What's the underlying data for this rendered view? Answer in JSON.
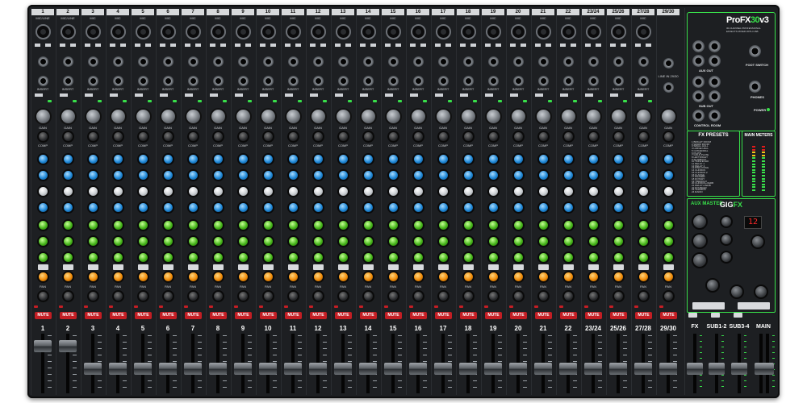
{
  "product": {
    "brand": "ProFX30v3",
    "brand_main": "ProFX",
    "brand_accent": "30",
    "brand_suffix": "v3",
    "subtitle": "30-CHANNEL PROFESSIONAL EFFECTS MIXER WITH USB"
  },
  "channels": [
    {
      "num": "1",
      "mic": "MIC/LINE",
      "label": "1"
    },
    {
      "num": "2",
      "mic": "MIC/LINE",
      "label": "2"
    },
    {
      "num": "3",
      "mic": "MIC",
      "label": "3"
    },
    {
      "num": "4",
      "mic": "MIC",
      "label": "4"
    },
    {
      "num": "5",
      "mic": "MIC",
      "label": "5"
    },
    {
      "num": "6",
      "mic": "MIC",
      "label": "6"
    },
    {
      "num": "7",
      "mic": "MIC",
      "label": "7"
    },
    {
      "num": "8",
      "mic": "MIC",
      "label": "8"
    },
    {
      "num": "9",
      "mic": "MIC",
      "label": "9"
    },
    {
      "num": "10",
      "mic": "MIC",
      "label": "10"
    },
    {
      "num": "11",
      "mic": "MIC",
      "label": "11"
    },
    {
      "num": "12",
      "mic": "MIC",
      "label": "12"
    },
    {
      "num": "13",
      "mic": "MIC",
      "label": "13"
    },
    {
      "num": "14",
      "mic": "MIC",
      "label": "14"
    },
    {
      "num": "15",
      "mic": "MIC",
      "label": "15"
    },
    {
      "num": "16",
      "mic": "MIC",
      "label": "16"
    },
    {
      "num": "17",
      "mic": "MIC",
      "label": "17"
    },
    {
      "num": "18",
      "mic": "MIC",
      "label": "18"
    },
    {
      "num": "19",
      "mic": "MIC",
      "label": "19"
    },
    {
      "num": "20",
      "mic": "MIC",
      "label": "20"
    },
    {
      "num": "21",
      "mic": "MIC",
      "label": "21"
    },
    {
      "num": "22",
      "mic": "MIC",
      "label": "22"
    },
    {
      "num": "23/24",
      "mic": "MIC",
      "label": "23/24"
    },
    {
      "num": "25/26",
      "mic": "MIC",
      "label": "25/26"
    },
    {
      "num": "27/28",
      "mic": "MIC",
      "label": "27/28"
    },
    {
      "num": "29/30",
      "mic": "",
      "label": "29/30"
    }
  ],
  "strip_labels": {
    "insert": "INSERT",
    "gain": "GAIN",
    "comp": "COMP",
    "mute": "MUTE",
    "pan": "PAN",
    "line_in": "LINE IN 29/30"
  },
  "right_panel": {
    "aux_out": "AUX OUT",
    "sub_out": "SUB OUT",
    "control_room": "CONTROL ROOM",
    "foot_switch": "FOOT SWITCH",
    "phones": "PHONES",
    "power": "POWER",
    "fx_presets_title": "FX PRESETS",
    "fx_presets": [
      "1 BRIGHT ROOM",
      "2 WARM ROOM",
      "3 SMALL HALL",
      "4 LARGE HALL",
      "5 CATHEDRAL",
      "6 PLATE",
      "7 GOLD PLATE",
      "8 LEFT/RIGHT",
      "9 SLAPBACK",
      "10 TAPE ECHO",
      "11 DELAY 1",
      "12 DELAY 2",
      "13 PING PONG",
      "14 CHORUS",
      "15 CHORUS 2",
      "16 FLANGE",
      "17 PHASER",
      "18 ROTARY",
      "19 TREMOLO",
      "20 CHORUS+VERB",
      "21 DELAY+VERB",
      "22 DOUBLER",
      "23 TALKBOX",
      "24 RADIO"
    ],
    "main_meters_title": "MAIN METERS",
    "aux_master": "AUX MASTER",
    "gigfx_main": "GIG",
    "gigfx_accent": "FX",
    "fx_display": "12",
    "fader_labels": [
      "FX",
      "SUB1-2",
      "SUB3-4",
      "MAIN"
    ]
  },
  "colors": {
    "accent_green": "#38e04a",
    "mute_red": "#c31e24",
    "eq_blue": "#1e87d6",
    "aux_green": "#46b51a",
    "pan_orange": "#f08c0a"
  }
}
